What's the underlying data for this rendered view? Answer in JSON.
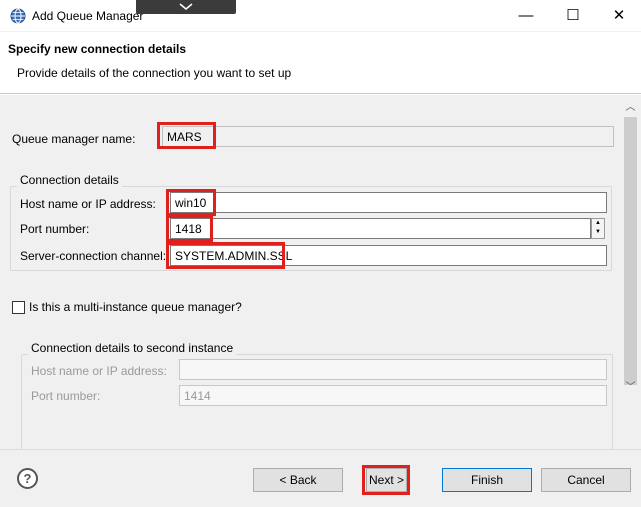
{
  "window": {
    "title": "Add Queue Manager",
    "minimize": "—",
    "maximize": "☐",
    "close": "✕"
  },
  "banner": {
    "title": "Specify new connection details",
    "subtitle": "Provide details of the connection you want to set up"
  },
  "form": {
    "qm_name_label": "Queue manager name:",
    "qm_name_value": "MARS",
    "connection_group_title": "Connection details",
    "host_label": "Host name or IP address:",
    "host_value": "win10",
    "port_label": "Port number:",
    "port_value": "1418",
    "channel_label": "Server-connection channel:",
    "channel_value": "SYSTEM.ADMIN.SSL",
    "multi_instance_label": "Is this a multi-instance queue manager?",
    "multi_instance_checked": false,
    "second_group_title": "Connection details to second instance",
    "second_host_label": "Host name or IP address:",
    "second_host_value": "",
    "second_port_label": "Port number:",
    "second_port_value": "1414"
  },
  "footer": {
    "help_label": "?",
    "back_label": "< Back",
    "next_label": "Next >",
    "finish_label": "Finish",
    "cancel_label": "Cancel"
  },
  "colors": {
    "highlight": "#e0201c",
    "default_button_border": "#0078d7"
  }
}
